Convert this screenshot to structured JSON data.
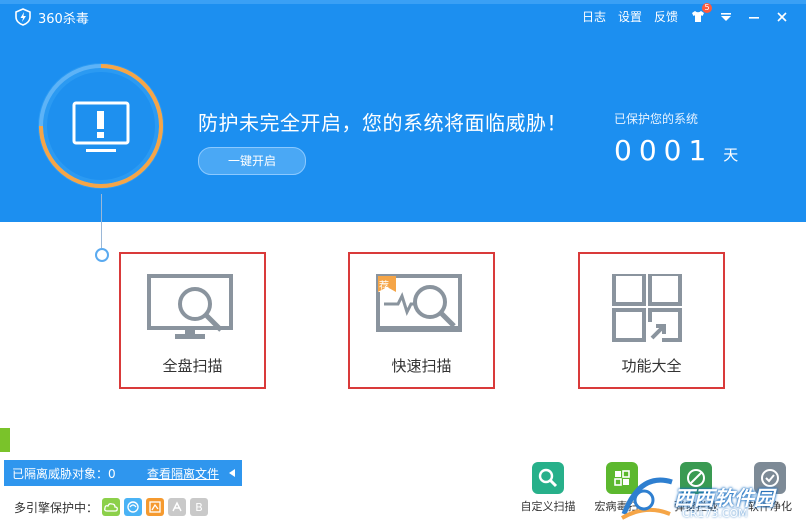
{
  "app": {
    "title": "360杀毒"
  },
  "topnav": {
    "log": "日志",
    "settings": "设置",
    "feedback": "反馈",
    "badge_count": "5"
  },
  "status": {
    "warning": "防护未完全开启，您的系统将面临威胁！",
    "enable_button": "一键开启",
    "protected_label": "已保护您的系统",
    "protected_days": "0001",
    "days_unit": "天"
  },
  "scan_options": [
    {
      "label": "全盘扫描"
    },
    {
      "label": "快速扫描",
      "badge": "荐"
    },
    {
      "label": "功能大全"
    }
  ],
  "quarantine": {
    "label": "已隔离威胁对象：0",
    "view_link": "查看隔离文件"
  },
  "engines": {
    "label": "多引擎保护中：",
    "b_label": "B"
  },
  "tools": [
    {
      "label": "自定义扫描"
    },
    {
      "label": "宏病毒扫描"
    },
    {
      "label": "弹窗拦截"
    },
    {
      "label": "软件净化"
    }
  ],
  "watermark": {
    "brand": "西西软件园",
    "url": "CR173.COM"
  },
  "colors": {
    "header_bg": "#1c8ff0",
    "highlight_border": "#d93a3a",
    "ring_orange": "#f5a547"
  }
}
